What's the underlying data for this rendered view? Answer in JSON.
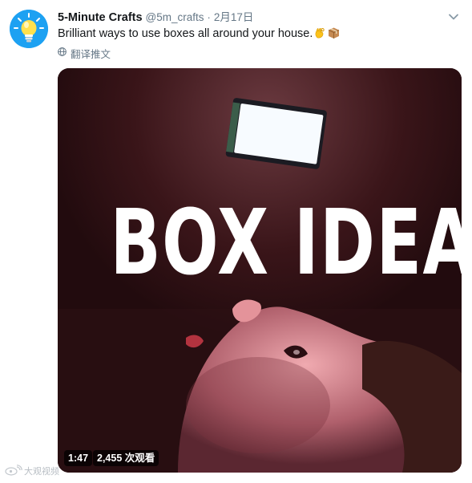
{
  "tweet": {
    "display_name": "5-Minute Crafts",
    "handle": "@5m_crafts",
    "separator": "·",
    "date": "2月17日",
    "text": "Brilliant ways to use boxes all around your house.",
    "emojis": [
      "ok-hand-emoji",
      "package-emoji"
    ],
    "translate_label": "翻译推文",
    "avatar_icon": "lightbulb-icon",
    "menu_icon": "chevron-down-icon"
  },
  "media": {
    "overlay_title": "BOX IDEAS",
    "duration": "1:47",
    "views": "2,455 次观看"
  },
  "watermark": {
    "text": "大观视频"
  },
  "colors": {
    "accent": "#1da1f2",
    "secondary_text": "#657786",
    "primary_text": "#14171a"
  }
}
